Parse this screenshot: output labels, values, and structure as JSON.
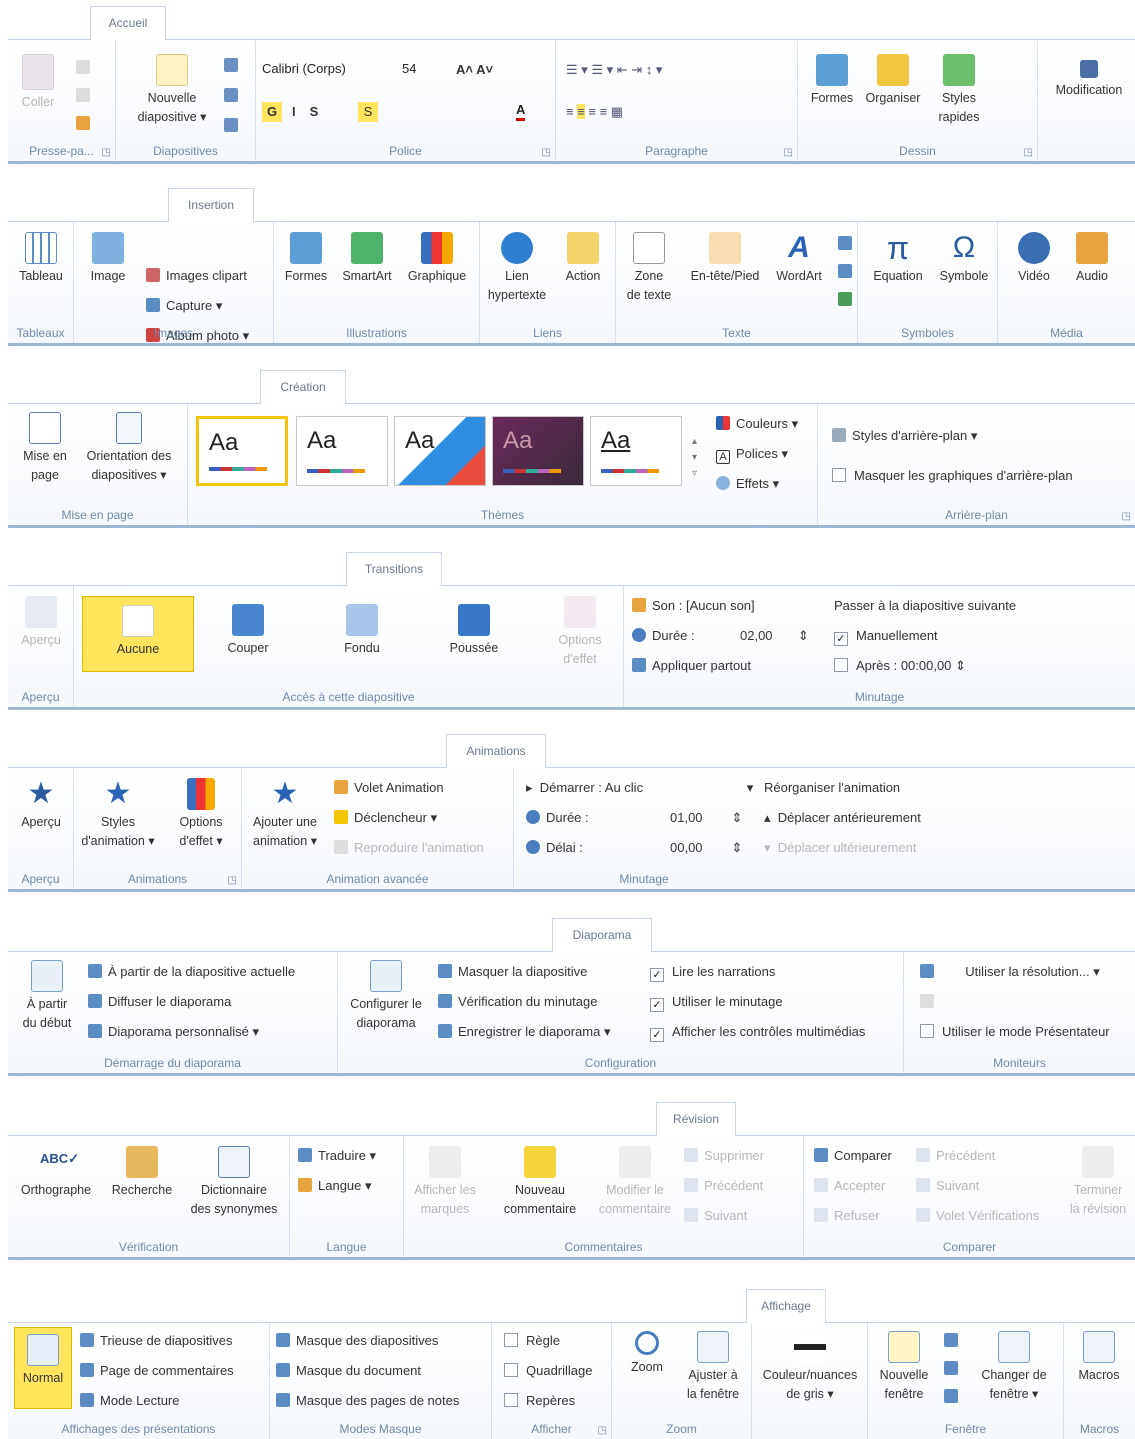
{
  "accueil": {
    "tab": "Accueil",
    "coller": "Coller",
    "nouvelle": "Nouvelle",
    "diapositive": "diapositive",
    "font_name": "Calibri (Corps)",
    "font_size": "54",
    "formes": "Formes",
    "organiser": "Organiser",
    "styles": "Styles",
    "rapides": "rapides",
    "modification": "Modification",
    "g_presse": "Presse-pa...",
    "g_diapos": "Diapositives",
    "g_police": "Police",
    "g_paragraphe": "Paragraphe",
    "g_dessin": "Dessin"
  },
  "insertion": {
    "tab": "Insertion",
    "tableau": "Tableau",
    "image": "Image",
    "images_clipart": "Images clipart",
    "capture": "Capture",
    "album": "Album photo",
    "formes": "Formes",
    "smartart": "SmartArt",
    "graphique": "Graphique",
    "lien": "Lien",
    "hypertexte": "hypertexte",
    "action": "Action",
    "zone": "Zone",
    "de_texte": "de texte",
    "entete": "En-tête/Pied",
    "wordart": "WordArt",
    "equation": "Equation",
    "symbole": "Symbole",
    "video": "Vidéo",
    "audio": "Audio",
    "g_tableaux": "Tableaux",
    "g_images": "Images",
    "g_illus": "Illustrations",
    "g_liens": "Liens",
    "g_texte": "Texte",
    "g_symboles": "Symboles",
    "g_media": "Média"
  },
  "creation": {
    "tab": "Création",
    "mise_en": "Mise en",
    "page": "page",
    "orientation": "Orientation des",
    "diapositives": "diapositives",
    "couleurs": "Couleurs",
    "polices": "Polices",
    "effets": "Effets",
    "styles_ap": "Styles d'arrière-plan",
    "masquer": "Masquer les graphiques d'arrière-plan",
    "aa": "Aa",
    "g_mise": "Mise en page",
    "g_themes": "Thèmes",
    "g_arriere": "Arrière-plan"
  },
  "transitions": {
    "tab": "Transitions",
    "apercu": "Aperçu",
    "aucune": "Aucune",
    "couper": "Couper",
    "fondu": "Fondu",
    "poussee": "Poussée",
    "options": "Options",
    "d_effet": "d'effet",
    "son": "Son :",
    "son_val": "[Aucun son]",
    "duree": "Durée :",
    "duree_val": "02,00",
    "appliquer": "Appliquer partout",
    "passer": "Passer à la diapositive suivante",
    "manuellement": "Manuellement",
    "apres": "Après :",
    "apres_val": "00:00,00",
    "g_apercu": "Aperçu",
    "g_acces": "Accès à cette diapositive",
    "g_minutage": "Minutage"
  },
  "animations": {
    "tab": "Animations",
    "apercu": "Aperçu",
    "styles": "Styles",
    "d_animation": "d'animation",
    "options": "Options",
    "d_effet": "d'effet",
    "ajouter": "Ajouter une",
    "animation": "animation",
    "volet": "Volet Animation",
    "declencheur": "Déclencheur",
    "reproduire": "Reproduire l'animation",
    "demarrer": "Démarrer :",
    "demarrer_val": "Au clic",
    "duree": "Durée :",
    "duree_val": "01,00",
    "delai": "Délai :",
    "delai_val": "00,00",
    "reorganiser": "Réorganiser l'animation",
    "depl_ant": "Déplacer antérieurement",
    "depl_ult": "Déplacer ultérieurement",
    "g_apercu": "Aperçu",
    "g_animations": "Animations",
    "g_avancee": "Animation avancée",
    "g_minutage": "Minutage"
  },
  "diaporama": {
    "tab": "Diaporama",
    "a_partir": "À partir",
    "du_debut": "du début",
    "partir_actuelle": "À partir de la diapositive actuelle",
    "diffuser": "Diffuser le diaporama",
    "personnalise": "Diaporama personnalisé",
    "configurer": "Configurer le",
    "diaporama": "diaporama",
    "masquer": "Masquer la diapositive",
    "verification": "Vérification du minutage",
    "enregistrer": "Enregistrer le diaporama",
    "lire": "Lire les narrations",
    "utiliser_min": "Utiliser le minutage",
    "afficher_ctrl": "Afficher les contrôles multimédias",
    "resolution": "Utiliser la résolution...",
    "presentateur": "Utiliser le mode Présentateur",
    "g_demarrage": "Démarrage du diaporama",
    "g_config": "Configuration",
    "g_moniteurs": "Moniteurs"
  },
  "revision": {
    "tab": "Révision",
    "orthographe": "Orthographe",
    "recherche": "Recherche",
    "dictionnaire": "Dictionnaire",
    "synonymes": "des synonymes",
    "traduire": "Traduire",
    "langue": "Langue",
    "afficher": "Afficher les",
    "marques": "marques",
    "nouveau": "Nouveau",
    "commentaire": "commentaire",
    "modifier": "Modifier le",
    "commentaire2": "commentaire",
    "supprimer": "Supprimer",
    "precedent": "Précédent",
    "suivant": "Suivant",
    "comparer": "Comparer",
    "accepter": "Accepter",
    "refuser": "Refuser",
    "precedent2": "Précédent",
    "suivant2": "Suivant",
    "volet_verif": "Volet Vérifications",
    "terminer": "Terminer",
    "la_revision": "la révision",
    "g_verif": "Vérification",
    "g_langue": "Langue",
    "g_comm": "Commentaires",
    "g_comparer": "Comparer"
  },
  "affichage": {
    "tab": "Affichage",
    "normal": "Normal",
    "trieuse": "Trieuse de diapositives",
    "page_comm": "Page de commentaires",
    "lecture": "Mode Lecture",
    "masque_diapos": "Masque des diapositives",
    "masque_doc": "Masque du document",
    "masque_notes": "Masque des pages de notes",
    "regle": "Règle",
    "quadrillage": "Quadrillage",
    "reperes": "Repères",
    "zoom": "Zoom",
    "ajuster": "Ajuster à",
    "la_fenetre": "la fenêtre",
    "couleur": "Couleur/nuances",
    "de_gris": "de gris",
    "nouvelle": "Nouvelle",
    "fenetre": "fenêtre",
    "changer": "Changer de",
    "fenetre2": "fenêtre",
    "macros": "Macros",
    "g_affichages": "Affichages des présentations",
    "g_masque": "Modes Masque",
    "g_afficher": "Afficher",
    "g_zoom": "Zoom",
    "g_fenetre": "Fenêtre",
    "g_macros": "Macros"
  }
}
